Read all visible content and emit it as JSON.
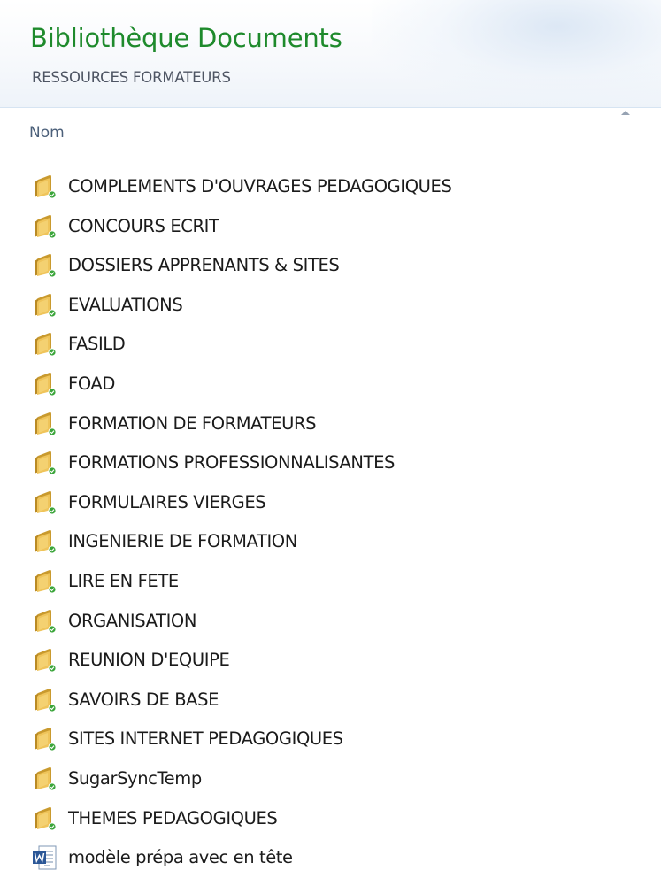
{
  "header": {
    "title": "Bibliothèque Documents",
    "subtitle": "RESSOURCES FORMATEURS"
  },
  "columns": {
    "name": "Nom"
  },
  "items": [
    {
      "label": "COMPLEMENTS D'OUVRAGES PEDAGOGIQUES",
      "icon": "folder-icon"
    },
    {
      "label": "CONCOURS ECRIT",
      "icon": "folder-icon"
    },
    {
      "label": "DOSSIERS APPRENANTS & SITES",
      "icon": "folder-icon"
    },
    {
      "label": "EVALUATIONS",
      "icon": "folder-icon"
    },
    {
      "label": "FASILD",
      "icon": "folder-icon"
    },
    {
      "label": "FOAD",
      "icon": "folder-icon"
    },
    {
      "label": "FORMATION DE FORMATEURS",
      "icon": "folder-icon"
    },
    {
      "label": "FORMATIONS PROFESSIONNALISANTES",
      "icon": "folder-icon"
    },
    {
      "label": "FORMULAIRES VIERGES",
      "icon": "folder-icon"
    },
    {
      "label": "INGENIERIE DE FORMATION",
      "icon": "folder-icon"
    },
    {
      "label": "LIRE EN FETE",
      "icon": "folder-icon"
    },
    {
      "label": "ORGANISATION",
      "icon": "folder-icon"
    },
    {
      "label": "REUNION D'EQUIPE",
      "icon": "folder-icon"
    },
    {
      "label": "SAVOIRS DE BASE",
      "icon": "folder-icon"
    },
    {
      "label": "SITES INTERNET PEDAGOGIQUES",
      "icon": "folder-icon"
    },
    {
      "label": "SugarSyncTemp",
      "icon": "folder-icon"
    },
    {
      "label": "THEMES PEDAGOGIQUES",
      "icon": "folder-icon"
    },
    {
      "label": "modèle prépa avec en tête",
      "icon": "word-document-icon"
    }
  ],
  "colors": {
    "title": "#1e8a2c",
    "folder": "#e8b84a",
    "sync_badge": "#3aa53a",
    "word": "#2b5797"
  }
}
